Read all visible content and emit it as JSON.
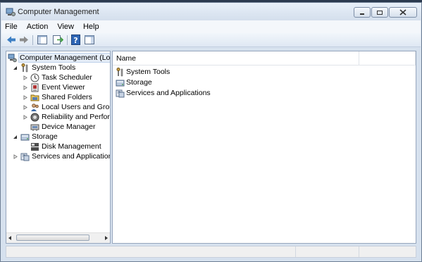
{
  "window": {
    "title": "Computer Management"
  },
  "menu": [
    "File",
    "Action",
    "View",
    "Help"
  ],
  "toolbar": {
    "buttons": [
      "back-icon",
      "forward-icon",
      "show-hide-console-tree-icon",
      "export-list-icon",
      "help-icon",
      "show-hide-action-pane-icon"
    ]
  },
  "tree": {
    "root": "Computer Management (Local)",
    "system_tools": "System Tools",
    "task_scheduler": "Task Scheduler",
    "event_viewer": "Event Viewer",
    "shared_folders": "Shared Folders",
    "local_users": "Local Users and Groups",
    "reliability": "Reliability and Performance",
    "device_manager": "Device Manager",
    "storage": "Storage",
    "disk_management": "Disk Management",
    "services": "Services and Applications"
  },
  "list": {
    "column_name": "Name",
    "items": [
      "System Tools",
      "Storage",
      "Services and Applications"
    ]
  },
  "colors": {
    "selection": "#e5edf7",
    "frame": "#d6e1ee"
  }
}
